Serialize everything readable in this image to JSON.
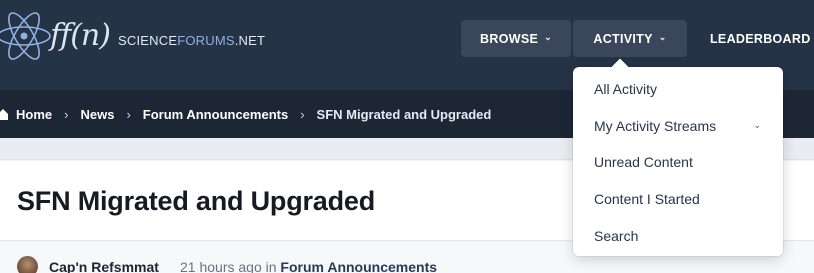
{
  "logo": {
    "mark": "ff(n)",
    "text_science": "SCIENCE",
    "text_forums": "FORUMS",
    "text_net": ".NET"
  },
  "nav": {
    "browse": "BROWSE",
    "activity": "ACTIVITY",
    "leaderboard": "LEADERBOARD"
  },
  "breadcrumb": {
    "items": [
      "Home",
      "News",
      "Forum Announcements",
      "SFN Migrated and Upgraded"
    ]
  },
  "topic": {
    "title": "SFN Migrated and Upgraded",
    "author": "Cap'n Refsmmat",
    "time_prefix": "21 hours ago in",
    "forum": "Forum Announcements"
  },
  "activity_menu": {
    "items": [
      "All Activity",
      "My Activity Streams",
      "Unread Content",
      "Content I Started",
      "Search"
    ]
  },
  "colors": {
    "header_bg": "#253347",
    "breadcrumb_bg": "#1c2635",
    "nav_button_bg": "#3a465a"
  },
  "icons": {
    "logo": "atom-icon",
    "home": "home-icon",
    "chevron": "chevron-down-icon",
    "separator": "chevron-right-icon"
  }
}
